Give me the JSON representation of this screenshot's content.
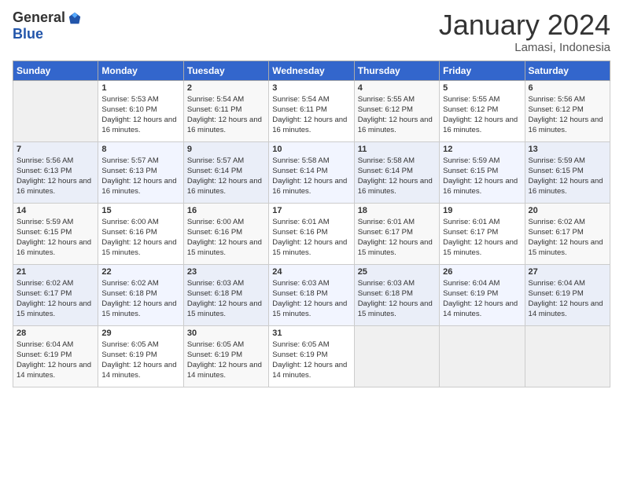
{
  "logo": {
    "general": "General",
    "blue": "Blue"
  },
  "title": "January 2024",
  "location": "Lamasi, Indonesia",
  "columns": [
    "Sunday",
    "Monday",
    "Tuesday",
    "Wednesday",
    "Thursday",
    "Friday",
    "Saturday"
  ],
  "weeks": [
    [
      {
        "day": "",
        "sunrise": "",
        "sunset": "",
        "daylight": ""
      },
      {
        "day": "1",
        "sunrise": "Sunrise: 5:53 AM",
        "sunset": "Sunset: 6:10 PM",
        "daylight": "Daylight: 12 hours and 16 minutes."
      },
      {
        "day": "2",
        "sunrise": "Sunrise: 5:54 AM",
        "sunset": "Sunset: 6:11 PM",
        "daylight": "Daylight: 12 hours and 16 minutes."
      },
      {
        "day": "3",
        "sunrise": "Sunrise: 5:54 AM",
        "sunset": "Sunset: 6:11 PM",
        "daylight": "Daylight: 12 hours and 16 minutes."
      },
      {
        "day": "4",
        "sunrise": "Sunrise: 5:55 AM",
        "sunset": "Sunset: 6:12 PM",
        "daylight": "Daylight: 12 hours and 16 minutes."
      },
      {
        "day": "5",
        "sunrise": "Sunrise: 5:55 AM",
        "sunset": "Sunset: 6:12 PM",
        "daylight": "Daylight: 12 hours and 16 minutes."
      },
      {
        "day": "6",
        "sunrise": "Sunrise: 5:56 AM",
        "sunset": "Sunset: 6:12 PM",
        "daylight": "Daylight: 12 hours and 16 minutes."
      }
    ],
    [
      {
        "day": "7",
        "sunrise": "Sunrise: 5:56 AM",
        "sunset": "Sunset: 6:13 PM",
        "daylight": "Daylight: 12 hours and 16 minutes."
      },
      {
        "day": "8",
        "sunrise": "Sunrise: 5:57 AM",
        "sunset": "Sunset: 6:13 PM",
        "daylight": "Daylight: 12 hours and 16 minutes."
      },
      {
        "day": "9",
        "sunrise": "Sunrise: 5:57 AM",
        "sunset": "Sunset: 6:14 PM",
        "daylight": "Daylight: 12 hours and 16 minutes."
      },
      {
        "day": "10",
        "sunrise": "Sunrise: 5:58 AM",
        "sunset": "Sunset: 6:14 PM",
        "daylight": "Daylight: 12 hours and 16 minutes."
      },
      {
        "day": "11",
        "sunrise": "Sunrise: 5:58 AM",
        "sunset": "Sunset: 6:14 PM",
        "daylight": "Daylight: 12 hours and 16 minutes."
      },
      {
        "day": "12",
        "sunrise": "Sunrise: 5:59 AM",
        "sunset": "Sunset: 6:15 PM",
        "daylight": "Daylight: 12 hours and 16 minutes."
      },
      {
        "day": "13",
        "sunrise": "Sunrise: 5:59 AM",
        "sunset": "Sunset: 6:15 PM",
        "daylight": "Daylight: 12 hours and 16 minutes."
      }
    ],
    [
      {
        "day": "14",
        "sunrise": "Sunrise: 5:59 AM",
        "sunset": "Sunset: 6:15 PM",
        "daylight": "Daylight: 12 hours and 16 minutes."
      },
      {
        "day": "15",
        "sunrise": "Sunrise: 6:00 AM",
        "sunset": "Sunset: 6:16 PM",
        "daylight": "Daylight: 12 hours and 15 minutes."
      },
      {
        "day": "16",
        "sunrise": "Sunrise: 6:00 AM",
        "sunset": "Sunset: 6:16 PM",
        "daylight": "Daylight: 12 hours and 15 minutes."
      },
      {
        "day": "17",
        "sunrise": "Sunrise: 6:01 AM",
        "sunset": "Sunset: 6:16 PM",
        "daylight": "Daylight: 12 hours and 15 minutes."
      },
      {
        "day": "18",
        "sunrise": "Sunrise: 6:01 AM",
        "sunset": "Sunset: 6:17 PM",
        "daylight": "Daylight: 12 hours and 15 minutes."
      },
      {
        "day": "19",
        "sunrise": "Sunrise: 6:01 AM",
        "sunset": "Sunset: 6:17 PM",
        "daylight": "Daylight: 12 hours and 15 minutes."
      },
      {
        "day": "20",
        "sunrise": "Sunrise: 6:02 AM",
        "sunset": "Sunset: 6:17 PM",
        "daylight": "Daylight: 12 hours and 15 minutes."
      }
    ],
    [
      {
        "day": "21",
        "sunrise": "Sunrise: 6:02 AM",
        "sunset": "Sunset: 6:17 PM",
        "daylight": "Daylight: 12 hours and 15 minutes."
      },
      {
        "day": "22",
        "sunrise": "Sunrise: 6:02 AM",
        "sunset": "Sunset: 6:18 PM",
        "daylight": "Daylight: 12 hours and 15 minutes."
      },
      {
        "day": "23",
        "sunrise": "Sunrise: 6:03 AM",
        "sunset": "Sunset: 6:18 PM",
        "daylight": "Daylight: 12 hours and 15 minutes."
      },
      {
        "day": "24",
        "sunrise": "Sunrise: 6:03 AM",
        "sunset": "Sunset: 6:18 PM",
        "daylight": "Daylight: 12 hours and 15 minutes."
      },
      {
        "day": "25",
        "sunrise": "Sunrise: 6:03 AM",
        "sunset": "Sunset: 6:18 PM",
        "daylight": "Daylight: 12 hours and 15 minutes."
      },
      {
        "day": "26",
        "sunrise": "Sunrise: 6:04 AM",
        "sunset": "Sunset: 6:19 PM",
        "daylight": "Daylight: 12 hours and 14 minutes."
      },
      {
        "day": "27",
        "sunrise": "Sunrise: 6:04 AM",
        "sunset": "Sunset: 6:19 PM",
        "daylight": "Daylight: 12 hours and 14 minutes."
      }
    ],
    [
      {
        "day": "28",
        "sunrise": "Sunrise: 6:04 AM",
        "sunset": "Sunset: 6:19 PM",
        "daylight": "Daylight: 12 hours and 14 minutes."
      },
      {
        "day": "29",
        "sunrise": "Sunrise: 6:05 AM",
        "sunset": "Sunset: 6:19 PM",
        "daylight": "Daylight: 12 hours and 14 minutes."
      },
      {
        "day": "30",
        "sunrise": "Sunrise: 6:05 AM",
        "sunset": "Sunset: 6:19 PM",
        "daylight": "Daylight: 12 hours and 14 minutes."
      },
      {
        "day": "31",
        "sunrise": "Sunrise: 6:05 AM",
        "sunset": "Sunset: 6:19 PM",
        "daylight": "Daylight: 12 hours and 14 minutes."
      },
      {
        "day": "",
        "sunrise": "",
        "sunset": "",
        "daylight": ""
      },
      {
        "day": "",
        "sunrise": "",
        "sunset": "",
        "daylight": ""
      },
      {
        "day": "",
        "sunrise": "",
        "sunset": "",
        "daylight": ""
      }
    ]
  ]
}
